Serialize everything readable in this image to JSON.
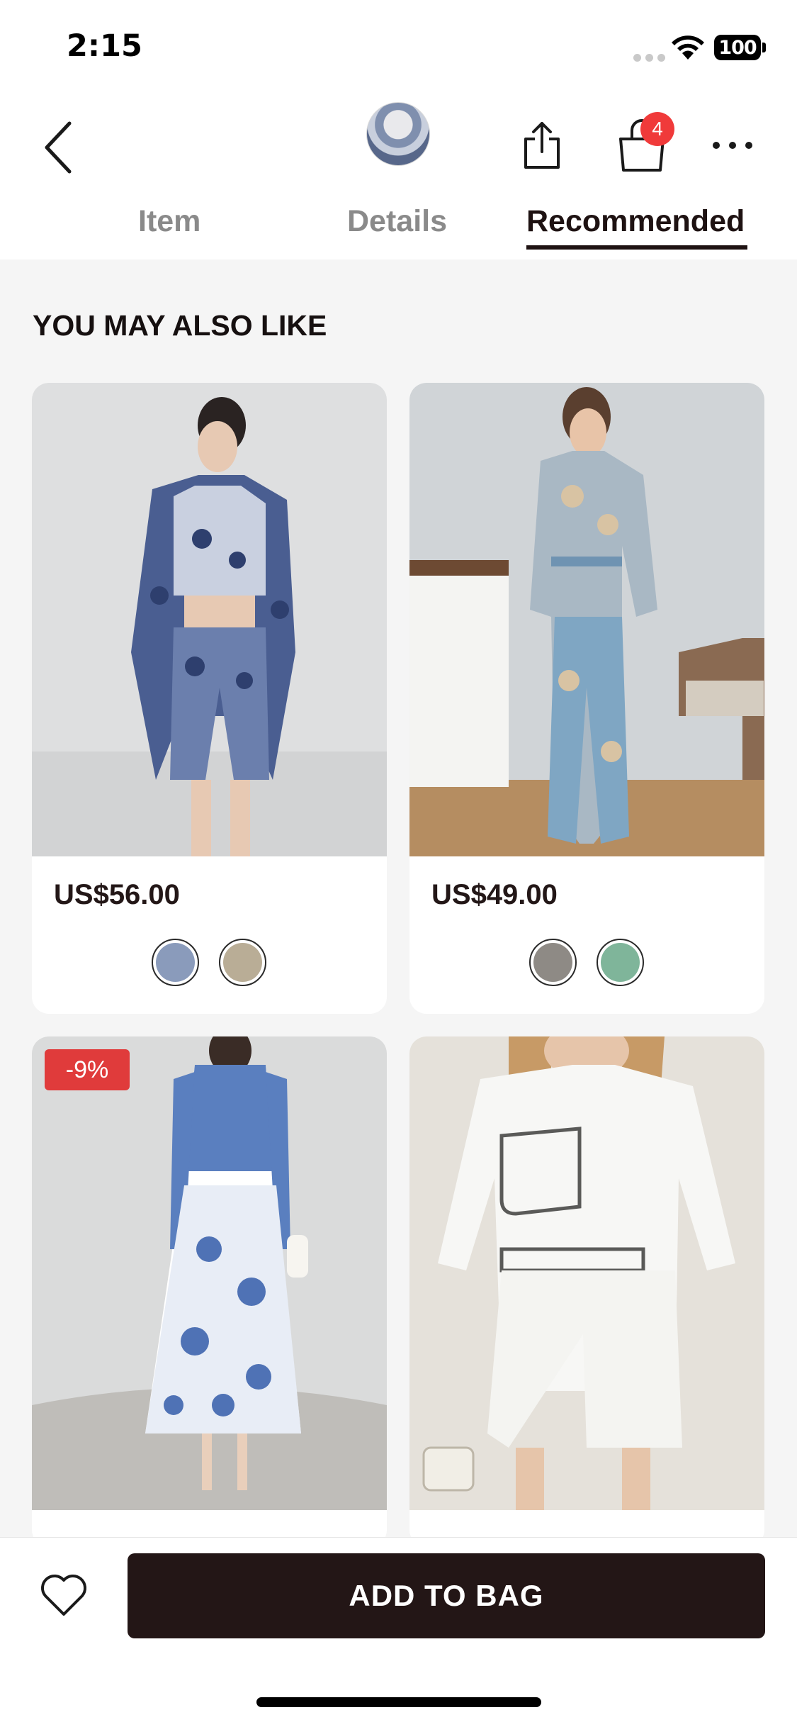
{
  "status_bar": {
    "time": "2:15",
    "battery": "100"
  },
  "header": {
    "icons": [
      "back-icon",
      "product-thumbnail",
      "share-icon",
      "bag-icon",
      "more-icon"
    ],
    "bag_count": "4"
  },
  "tabs": [
    {
      "label": "Item",
      "active": false
    },
    {
      "label": "Details",
      "active": false
    },
    {
      "label": "Recommended",
      "active": true
    }
  ],
  "section": {
    "title": "YOU MAY ALSO LIKE"
  },
  "products": [
    {
      "price": "US$56.00",
      "swatch_colors": [
        "#8a9bbb",
        "#b9ad96"
      ],
      "image_palette": [
        "#dfe0e2",
        "#4c5f8e"
      ]
    },
    {
      "price": "US$49.00",
      "swatch_colors": [
        "#8e8a85",
        "#7fb59a"
      ],
      "image_palette": [
        "#cfd3d6",
        "#7fa6c3"
      ]
    },
    {
      "discount": "-9%",
      "image_palette": [
        "#dadbdb",
        "#4f72b5"
      ]
    },
    {
      "image_palette": [
        "#e2ddd5",
        "#f7f7f5"
      ]
    }
  ],
  "bottom_bar": {
    "add_to_bag_label": "ADD TO BAG"
  },
  "colors": {
    "accent": "#231616",
    "badge": "#f03a3a",
    "discount": "#e03b3b"
  }
}
